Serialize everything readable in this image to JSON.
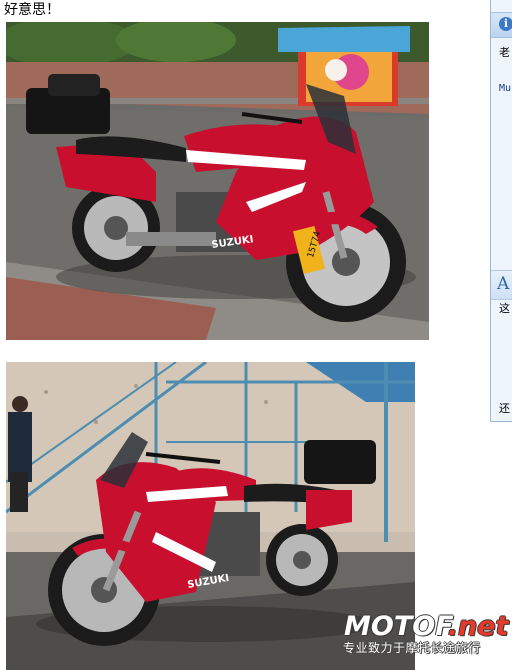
{
  "post": {
    "text": "好意思！"
  },
  "photos": [
    {
      "subject": "red motorcycle parked on street, side view facing right"
    },
    {
      "subject": "red motorcycle parked near staircase, side view facing left"
    }
  ],
  "side_panel": {
    "icon": "info-icon",
    "line1": "老",
    "line2": "Mu",
    "heading": "A",
    "line3": "这",
    "line4": "还"
  },
  "motorcycle": {
    "brand_text": "SUZUKI",
    "plate_text": "15T74"
  },
  "watermark": {
    "brand_prefix": "MOTOF",
    "brand_suffix": ".net",
    "tagline": "专业致力于摩托长途旅行"
  },
  "colors": {
    "bike_red": "#c8102e",
    "panel_bg": "#eef4fb",
    "panel_border": "#9cb6d6",
    "watermark_accent": "#e63a2a"
  }
}
